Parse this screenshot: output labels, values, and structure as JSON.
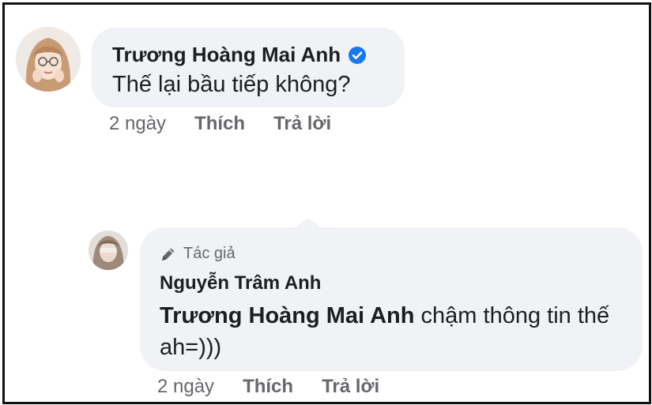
{
  "comment1": {
    "author": "Trương Hoàng Mai Anh",
    "verified": true,
    "text": "Thế lại bầu tiếp không?",
    "time": "2 ngày",
    "like_label": "Thích",
    "reply_label": "Trả lời"
  },
  "comment2": {
    "badge": "Tác giả",
    "author": "Nguyễn Trâm Anh",
    "mention": "Trương Hoàng Mai Anh",
    "text": " chậm thông tin thế ah=)))",
    "time": "2 ngày",
    "like_label": "Thích",
    "reply_label": "Trả lời"
  },
  "colors": {
    "bubble": "#f0f2f5",
    "text": "#1c1e21",
    "secondary": "#65676b",
    "verified_badge": "#1877f2"
  },
  "icons": [
    "verified-badge-icon",
    "pencil-icon"
  ]
}
